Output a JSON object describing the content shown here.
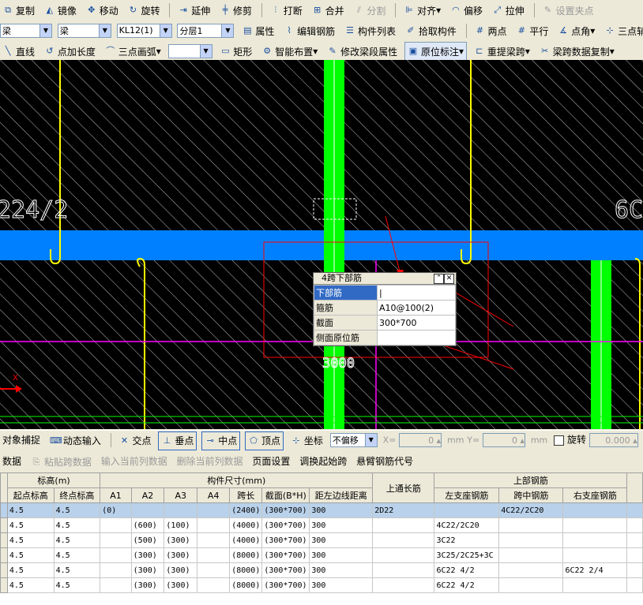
{
  "toolbar1": {
    "items": [
      "复制",
      "镜像",
      "移动",
      "旋转",
      "延伸",
      "修剪",
      "打断",
      "合并",
      "分割",
      "对齐",
      "偏移",
      "拉伸",
      "设置夹点"
    ]
  },
  "toolbar2": {
    "type_select": "梁",
    "subtype_select": "梁",
    "element_select": "KL12(1)",
    "layer_select": "分层1",
    "items": [
      "属性",
      "编辑钢筋",
      "构件列表",
      "拾取构件",
      "两点",
      "平行",
      "点角",
      "三点辅轴"
    ]
  },
  "toolbar3": {
    "items": [
      "直线",
      "点加长度",
      "三点画弧",
      "矩形",
      "智能布置",
      "修改梁段属性",
      "原位标注",
      "重提梁跨",
      "梁跨数据复制"
    ]
  },
  "canvas": {
    "text_left": "224/2",
    "text_right": "6C",
    "text_dim": "3000"
  },
  "popup": {
    "title": "4跨下部筋",
    "rows": [
      {
        "key": "下部筋",
        "value": ""
      },
      {
        "key": "箍筋",
        "value": "A10@100(2)"
      },
      {
        "key": "截面",
        "value": "300*700"
      },
      {
        "key": "侧面原位筋",
        "value": ""
      }
    ]
  },
  "snapbar": {
    "items": [
      "对象捕捉",
      "动态输入",
      "交点",
      "垂点",
      "中点",
      "顶点",
      "坐标"
    ],
    "offset_select": "不偏移",
    "x_label": "X=",
    "x_value": "0",
    "y_label": "Y=",
    "y_value": "0",
    "unit": "mm",
    "rotate_label": "旋转",
    "rotate_value": "0.000"
  },
  "cmdbar": {
    "items": [
      "数据",
      "粘贴跨数据",
      "输入当前列数据",
      "删除当前列数据",
      "页面设置",
      "调换起始跨",
      "悬臂钢筋代号"
    ]
  },
  "grid": {
    "group_headers": {
      "elev": "标高(m)",
      "size": "构件尺寸(mm)",
      "top_long": "上通长筋",
      "top_rebar": "上部钢筋"
    },
    "columns": [
      "起点标高",
      "终点标高",
      "A1",
      "A2",
      "A3",
      "A4",
      "跨长",
      "截面(B*H)",
      "距左边线距离",
      "",
      "左支座钢筋",
      "跨中钢筋",
      "右支座钢筋"
    ],
    "rows": [
      [
        "4.5",
        "4.5",
        "(0)",
        "",
        "",
        "",
        "(2400)",
        "(300*700)",
        "300",
        "2D22",
        "",
        "4C22/2C20",
        ""
      ],
      [
        "4.5",
        "4.5",
        "",
        "(600)",
        "(100)",
        "",
        "(4000)",
        "(300*700)",
        "300",
        "",
        "4C22/2C20",
        "",
        ""
      ],
      [
        "4.5",
        "4.5",
        "",
        "(500)",
        "(300)",
        "",
        "(4000)",
        "(300*700)",
        "300",
        "",
        "3C22",
        "",
        ""
      ],
      [
        "4.5",
        "4.5",
        "",
        "(300)",
        "(300)",
        "",
        "(8000)",
        "(300*700)",
        "300",
        "",
        "3C25/2C25+3C",
        "",
        ""
      ],
      [
        "4.5",
        "4.5",
        "",
        "(300)",
        "(300)",
        "",
        "(8000)",
        "(300*700)",
        "300",
        "",
        "6C22 4/2",
        "",
        "6C22 2/4"
      ],
      [
        "4.5",
        "4.5",
        "",
        "(300)",
        "(300)",
        "",
        "(8000)",
        "(300*700)",
        "300",
        "",
        "6C22 4/2",
        "",
        ""
      ]
    ]
  }
}
